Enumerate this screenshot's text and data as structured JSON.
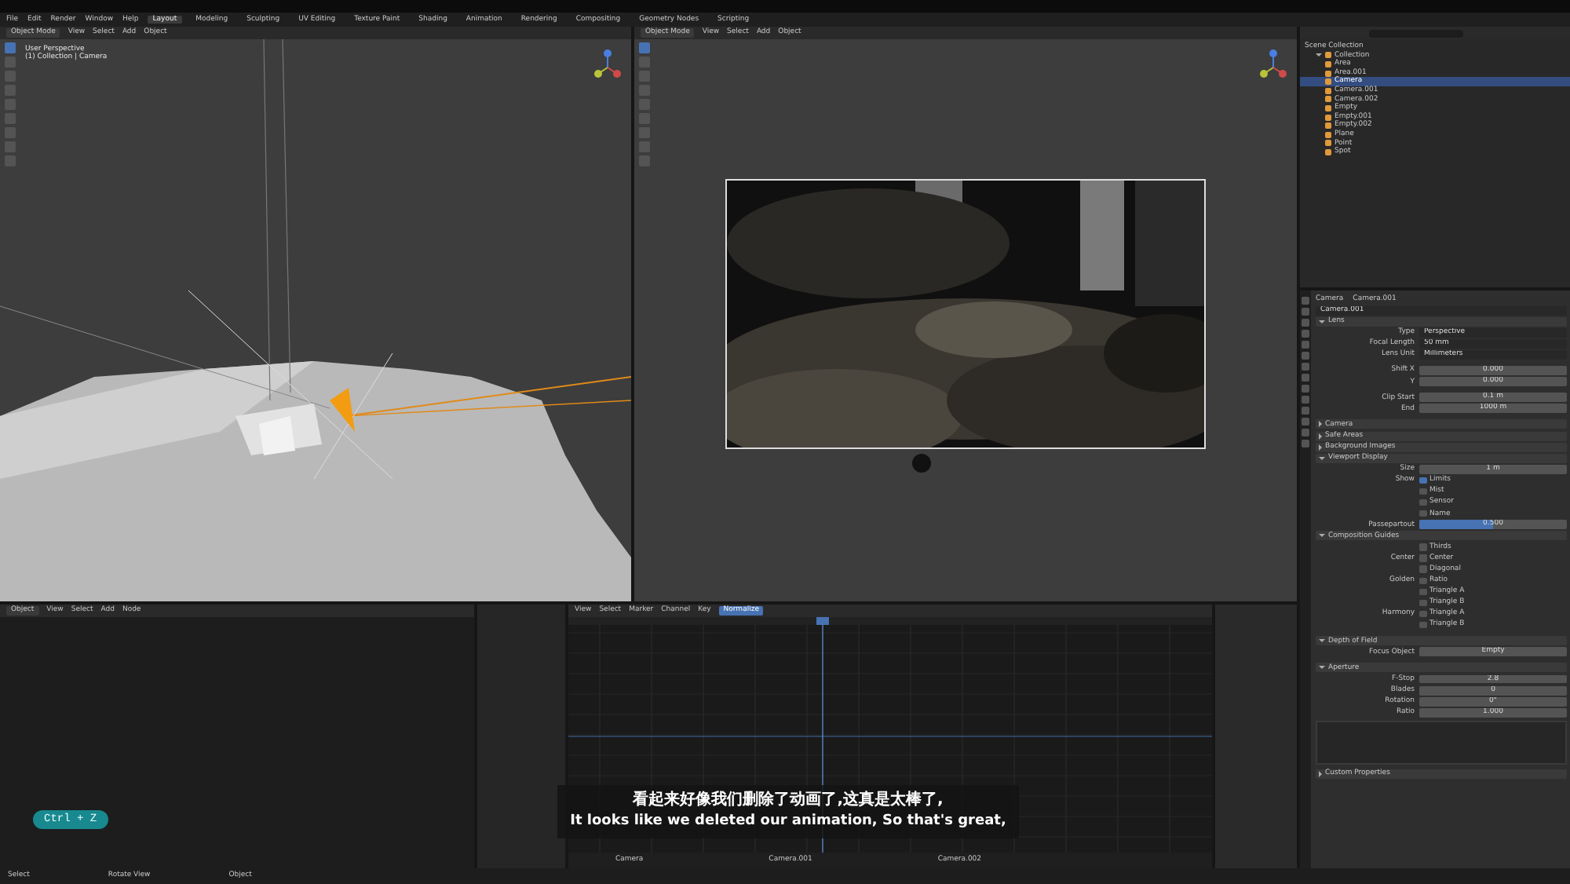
{
  "menu": [
    "File",
    "Edit",
    "Render",
    "Window",
    "Help"
  ],
  "workspaces": [
    {
      "label": "Layout",
      "selected": true
    },
    {
      "label": "Modeling",
      "selected": false
    },
    {
      "label": "Sculpting",
      "selected": false
    },
    {
      "label": "UV Editing",
      "selected": false
    },
    {
      "label": "Texture Paint",
      "selected": false
    },
    {
      "label": "Shading",
      "selected": false
    },
    {
      "label": "Animation",
      "selected": false
    },
    {
      "label": "Rendering",
      "selected": false
    },
    {
      "label": "Compositing",
      "selected": false
    },
    {
      "label": "Geometry Nodes",
      "selected": false
    },
    {
      "label": "Scripting",
      "selected": false
    }
  ],
  "viewport_left": {
    "mode": "Object Mode",
    "menus": [
      "View",
      "Select",
      "Add",
      "Object"
    ],
    "overlay_text": [
      "User Perspective",
      "(1) Collection | Camera"
    ]
  },
  "viewport_right": {
    "mode": "Object Mode",
    "menus": [
      "View",
      "Select",
      "Add",
      "Object"
    ]
  },
  "outliner": {
    "root": "Scene Collection",
    "items": [
      {
        "label": "Collection",
        "expanded": true,
        "selected": false,
        "children": [
          {
            "label": "Area",
            "selected": false
          },
          {
            "label": "Area.001",
            "selected": false
          },
          {
            "label": "Camera",
            "selected": true
          },
          {
            "label": "Camera.001",
            "selected": false
          },
          {
            "label": "Camera.002",
            "selected": false
          },
          {
            "label": "Empty",
            "selected": false
          },
          {
            "label": "Empty.001",
            "selected": false
          },
          {
            "label": "Empty.002",
            "selected": false
          },
          {
            "label": "Plane",
            "selected": false
          },
          {
            "label": "Point",
            "selected": false
          },
          {
            "label": "Spot",
            "selected": false
          }
        ]
      }
    ]
  },
  "properties": {
    "breadcrumb": [
      "Camera",
      "Camera.001"
    ],
    "name": "Camera.001",
    "rows": [
      {
        "kind": "panel",
        "label": "Lens",
        "expanded": true
      },
      {
        "kind": "field",
        "label": "Type",
        "value": "Perspective"
      },
      {
        "kind": "field",
        "label": "Focal Length",
        "value": "50 mm"
      },
      {
        "kind": "field",
        "label": "Lens Unit",
        "value": "Millimeters"
      },
      {
        "kind": "gap"
      },
      {
        "kind": "field",
        "label": "Shift X",
        "value": "0.000"
      },
      {
        "kind": "field",
        "label": "Y",
        "value": "0.000"
      },
      {
        "kind": "gap"
      },
      {
        "kind": "field",
        "label": "Clip Start",
        "value": "0.1 m"
      },
      {
        "kind": "field",
        "label": "End",
        "value": "1000 m"
      },
      {
        "kind": "gap"
      },
      {
        "kind": "panel",
        "label": "Camera",
        "expanded": false
      },
      {
        "kind": "panel",
        "label": "Safe Areas",
        "expanded": false
      },
      {
        "kind": "panel",
        "label": "Background Images",
        "expanded": false
      },
      {
        "kind": "panel",
        "label": "Viewport Display",
        "expanded": true
      },
      {
        "kind": "field",
        "label": "Size",
        "value": "1 m"
      },
      {
        "kind": "check",
        "group": "Show",
        "label": "Limits",
        "checked": true
      },
      {
        "kind": "check",
        "label": "Mist",
        "checked": false
      },
      {
        "kind": "check",
        "label": "Sensor",
        "checked": false
      },
      {
        "kind": "check",
        "label": "Name",
        "checked": false
      },
      {
        "kind": "slider",
        "label": "Passepartout",
        "value": "0.500",
        "level": 0.5
      },
      {
        "kind": "panel",
        "label": "Composition Guides",
        "expanded": true
      },
      {
        "kind": "check",
        "label": "Thirds",
        "checked": false
      },
      {
        "kind": "check",
        "group": "Center",
        "label": "Center",
        "checked": false
      },
      {
        "kind": "check",
        "label": "Diagonal",
        "checked": false
      },
      {
        "kind": "check",
        "group": "Golden",
        "label": "Ratio",
        "checked": false
      },
      {
        "kind": "check",
        "label": "Triangle A",
        "checked": false
      },
      {
        "kind": "check",
        "label": "Triangle B",
        "checked": false
      },
      {
        "kind": "check",
        "group": "Harmony",
        "label": "Triangle A",
        "checked": false
      },
      {
        "kind": "check",
        "label": "Triangle B",
        "checked": false
      },
      {
        "kind": "gap"
      },
      {
        "kind": "panel",
        "label": "Depth of Field",
        "expanded": true
      },
      {
        "kind": "field",
        "label": "Focus Object",
        "value": "Empty"
      },
      {
        "kind": "gap"
      },
      {
        "kind": "panel",
        "label": "Aperture",
        "expanded": true
      },
      {
        "kind": "field",
        "label": "F-Stop",
        "value": "2.8"
      },
      {
        "kind": "field",
        "label": "Blades",
        "value": "0"
      },
      {
        "kind": "field",
        "label": "Rotation",
        "value": "0°"
      },
      {
        "kind": "field",
        "label": "Ratio",
        "value": "1.000"
      },
      {
        "kind": "list"
      },
      {
        "kind": "panel",
        "label": "Custom Properties",
        "expanded": false
      }
    ]
  },
  "node_editor": {
    "mode": "Object",
    "menus": [
      "View",
      "Select",
      "Add",
      "Node"
    ]
  },
  "graph_editor": {
    "menus": [
      "View",
      "Select",
      "Marker",
      "Channel",
      "Key"
    ],
    "mode": "Normalize",
    "markers": [
      "Camera",
      "Camera.001",
      "Camera.002"
    ]
  },
  "status_bar": [
    "Select",
    "Rotate View",
    "Object"
  ],
  "key_hint": "Ctrl + Z",
  "subtitles": [
    "看起来好像我们删除了动画了,这真是太棒了,",
    "It looks like we deleted our animation, So that's great,"
  ]
}
